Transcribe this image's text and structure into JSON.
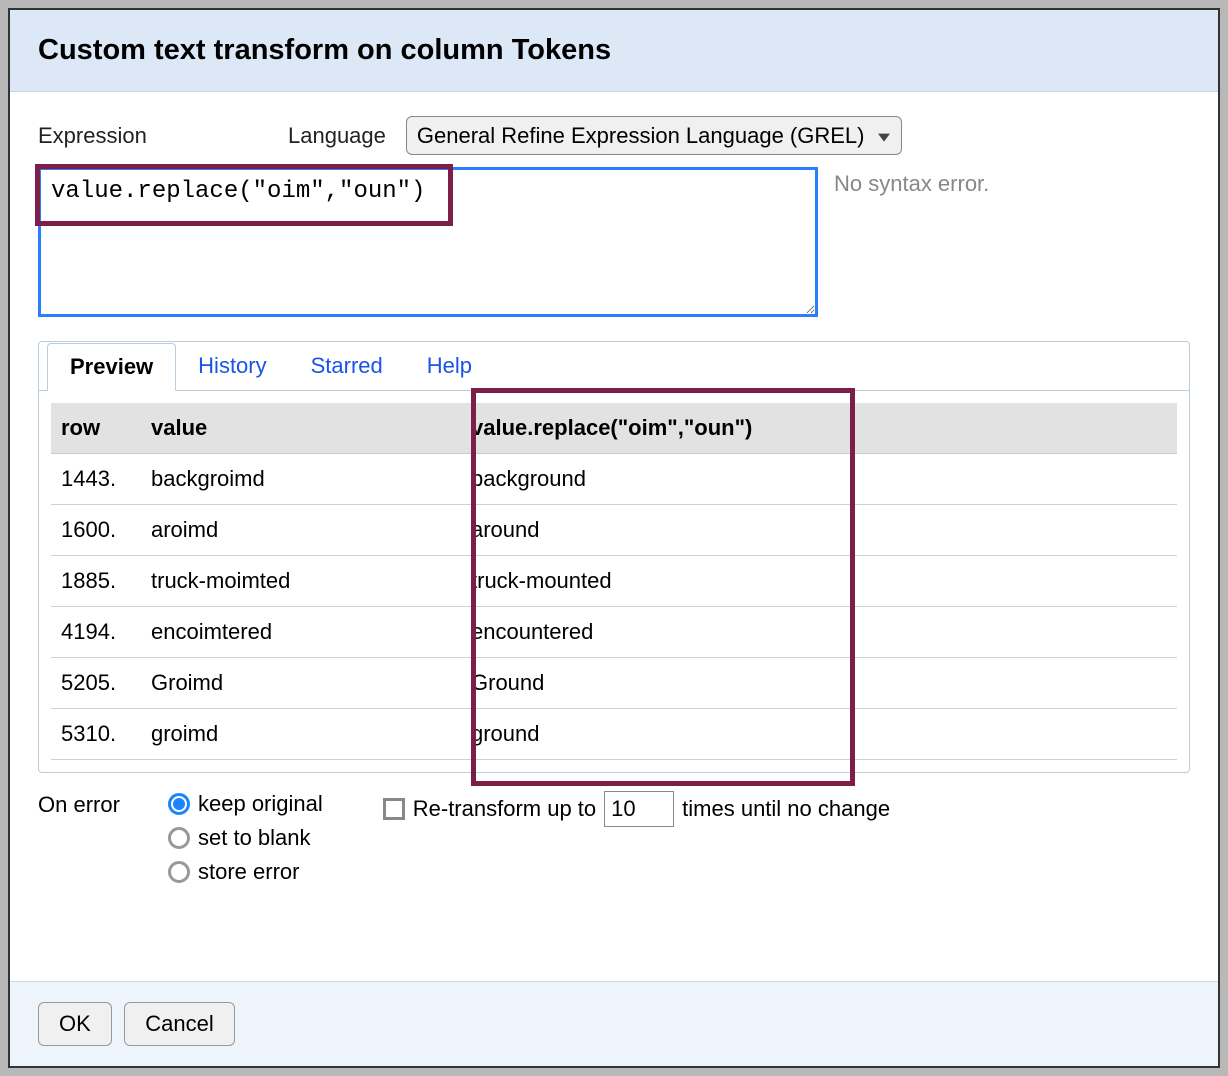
{
  "dialog": {
    "title": "Custom text transform on column Tokens"
  },
  "expression": {
    "label": "Expression",
    "language_label": "Language",
    "language_value": "General Refine Expression Language (GREL)",
    "value": "value.replace(\"oim\",\"oun\")",
    "syntax_message": "No syntax error."
  },
  "tabs": {
    "items": [
      "Preview",
      "History",
      "Starred",
      "Help"
    ],
    "active": 0
  },
  "preview": {
    "headers": {
      "row": "row",
      "value": "value",
      "result": "value.replace(\"oim\",\"oun\")"
    },
    "rows": [
      {
        "row": "1443.",
        "value": "backgroimd",
        "result": "background"
      },
      {
        "row": "1600.",
        "value": "aroimd",
        "result": "around"
      },
      {
        "row": "1885.",
        "value": "truck-moimted",
        "result": "truck-mounted"
      },
      {
        "row": "4194.",
        "value": "encoimtered",
        "result": "encountered"
      },
      {
        "row": "5205.",
        "value": "Groimd",
        "result": "Ground"
      },
      {
        "row": "5310.",
        "value": "groimd",
        "result": "ground"
      }
    ]
  },
  "on_error": {
    "label": "On error",
    "options": [
      "keep original",
      "set to blank",
      "store error"
    ],
    "selected": 0
  },
  "retransform": {
    "checked": false,
    "prefix": "Re-transform up to",
    "value": "10",
    "suffix": "times until no change"
  },
  "buttons": {
    "ok": "OK",
    "cancel": "Cancel"
  }
}
